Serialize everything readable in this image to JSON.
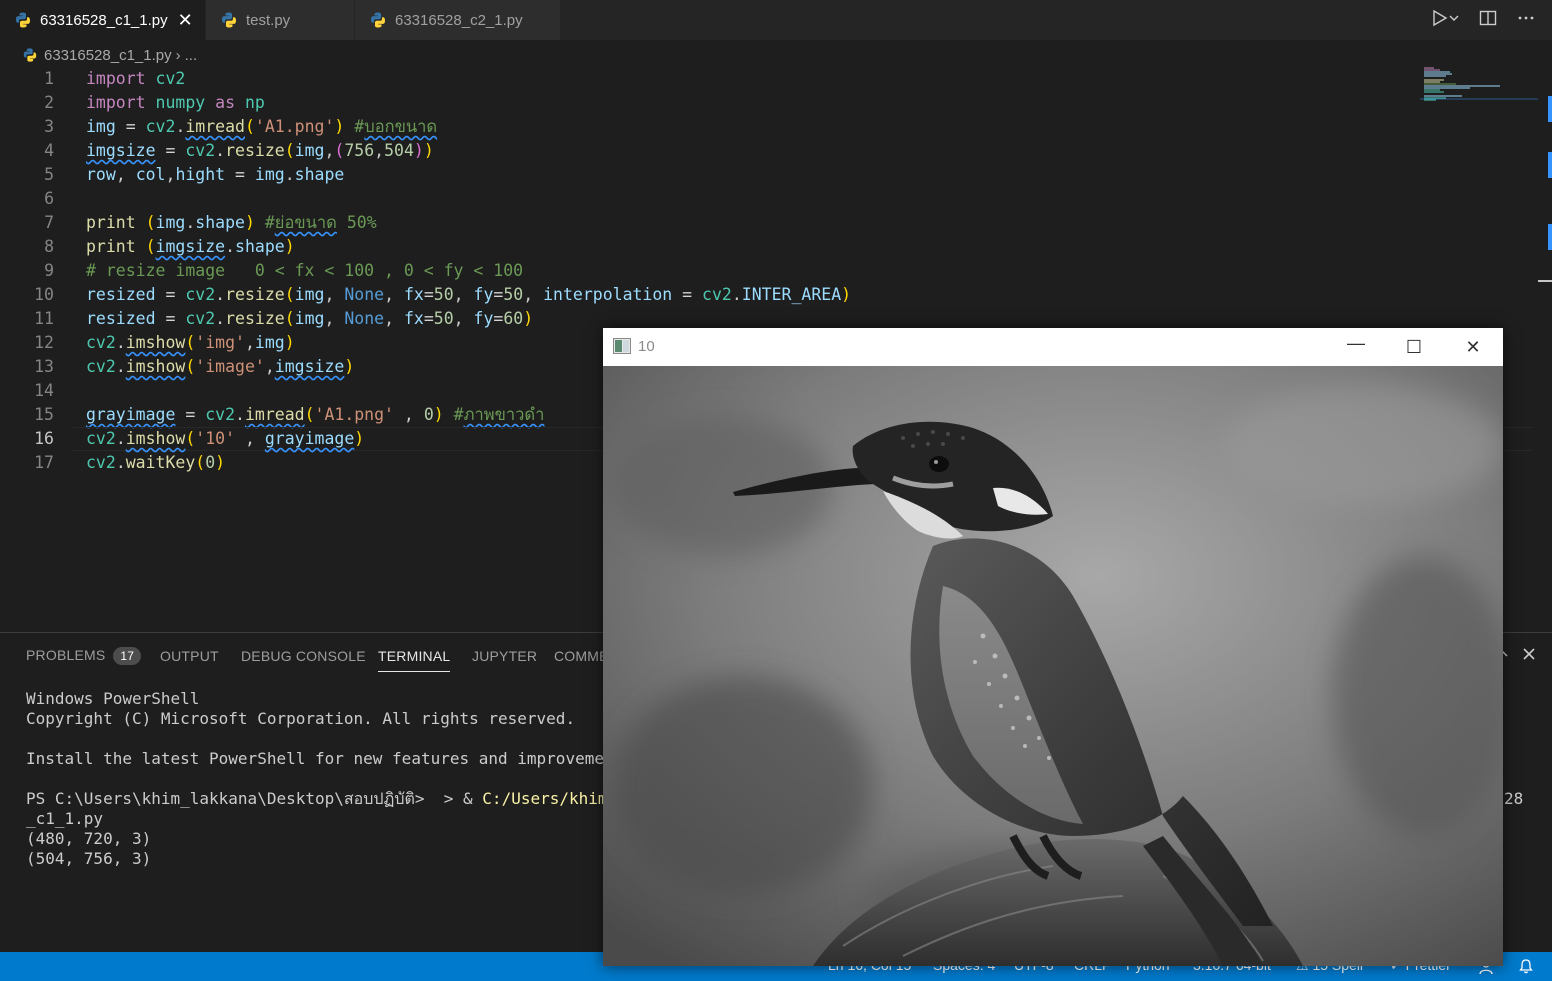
{
  "tabs": [
    {
      "label": "63316528_c1_1.py",
      "active": true
    },
    {
      "label": "test.py",
      "active": false
    },
    {
      "label": "63316528_c2_1.py",
      "active": false
    }
  ],
  "tab_close_glyph": "✕",
  "breadcrumb": {
    "file": "63316528_c1_1.py",
    "sep": "›",
    "more": "..."
  },
  "editor": {
    "line_numbers": [
      "1",
      "2",
      "3",
      "4",
      "5",
      "6",
      "7",
      "8",
      "9",
      "10",
      "11",
      "12",
      "13",
      "14",
      "15",
      "16",
      "17"
    ],
    "current_line": "16"
  },
  "panel": {
    "tabs": [
      {
        "label": "PROBLEMS",
        "badge": "17"
      },
      {
        "label": "OUTPUT"
      },
      {
        "label": "DEBUG CONSOLE"
      },
      {
        "label": "TERMINAL",
        "active": true
      },
      {
        "label": "JUPYTER"
      },
      {
        "label": "COMME"
      }
    ],
    "terminal": {
      "l1": "Windows PowerShell",
      "l2": "Copyright (C) Microsoft Corporation. All rights reserved.",
      "l3": "Install the latest PowerShell for new features and improvements!",
      "prompt": "PS C:\\Users\\khim_lakkana\\Desktop\\สอบปฏิบัติ>  > & ",
      "cmd": "C:/Users/khim_lak",
      "l5": "_c1_1.py",
      "l6": "(480, 720, 3)",
      "l7": "(504, 756, 3)",
      "right_fragment": "28"
    }
  },
  "statusbar": {
    "ln_col": "Ln 16, Col 15",
    "spaces": "Spaces: 4",
    "encoding": "UTF-8",
    "eol": "CRLF",
    "language": "Python",
    "interpreter": "3.10.7 64-bit",
    "spell": "15 Spell",
    "prettier": "Prettier"
  },
  "image_window": {
    "title": "10",
    "minimize": "—",
    "maximize": "☐",
    "close": "✕",
    "image": "grayscale kingfisher perched on branch"
  },
  "colors": {
    "accent": "#007acc",
    "editor_bg": "#1e1e1e",
    "keyword": "#c586c0",
    "string": "#ce9178",
    "comment": "#6a9955"
  }
}
